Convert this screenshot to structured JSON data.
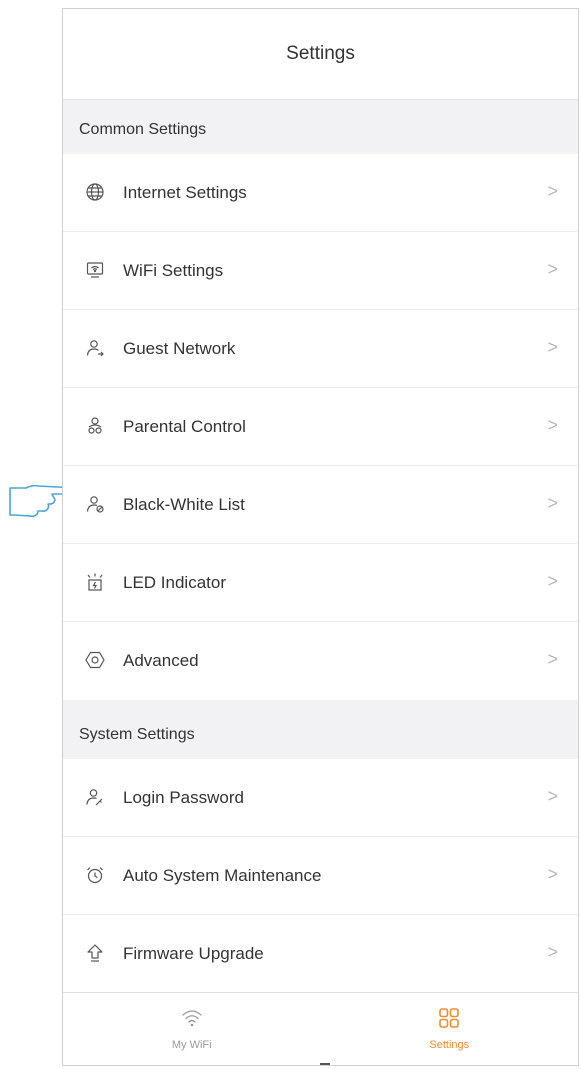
{
  "header": {
    "title": "Settings"
  },
  "sections": [
    {
      "title": "Common Settings",
      "items": [
        {
          "label": "Internet Settings",
          "icon": "globe-icon"
        },
        {
          "label": "WiFi Settings",
          "icon": "wifi-screen-icon"
        },
        {
          "label": "Guest Network",
          "icon": "guest-user-icon"
        },
        {
          "label": "Parental Control",
          "icon": "parental-control-icon"
        },
        {
          "label": "Black-White List",
          "icon": "blacklist-user-icon"
        },
        {
          "label": "LED Indicator",
          "icon": "led-indicator-icon"
        },
        {
          "label": "Advanced",
          "icon": "hexagon-gear-icon"
        }
      ]
    },
    {
      "title": "System Settings",
      "items": [
        {
          "label": "Login Password",
          "icon": "user-key-icon"
        },
        {
          "label": "Auto System Maintenance",
          "icon": "alarm-clock-icon"
        },
        {
          "label": "Firmware Upgrade",
          "icon": "upload-arrow-icon"
        }
      ]
    }
  ],
  "chevron": ">",
  "tabbar": {
    "tabs": [
      {
        "label": "My WiFi",
        "icon": "wifi-icon",
        "active": false
      },
      {
        "label": "Settings",
        "icon": "grid-settings-icon",
        "active": true
      }
    ]
  },
  "colors": {
    "accent": "#f08b2d",
    "inactive": "#999999",
    "background": "#f2f2f4"
  }
}
